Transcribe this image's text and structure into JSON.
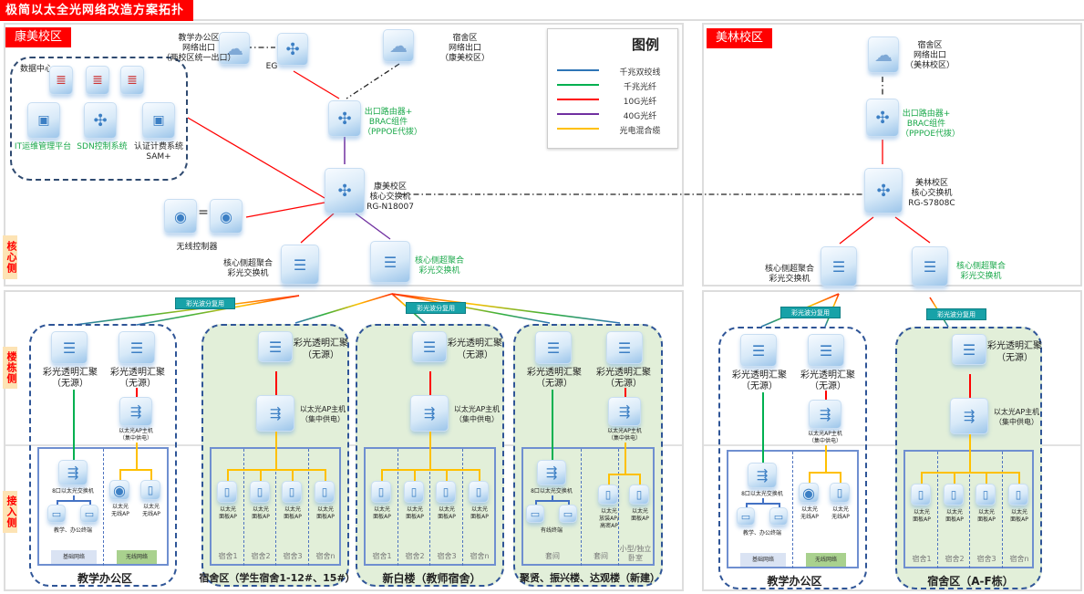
{
  "title": "极简以太全光网络改造方案拓扑示意图",
  "side_labels": {
    "core": "核心侧",
    "building": "楼栋侧",
    "access": "接入侧"
  },
  "legend": {
    "title": "图例",
    "items": [
      {
        "label": "千兆双绞线",
        "color": "#2e75b6"
      },
      {
        "label": "千兆光纤",
        "color": "#00b050"
      },
      {
        "label": "10G光纤",
        "color": "#ff0000"
      },
      {
        "label": "40G光纤",
        "color": "#7030a0"
      },
      {
        "label": "光电混合缆",
        "color": "#ffc000"
      }
    ]
  },
  "wdm_label": "彩光波分复用",
  "kangmei": {
    "name": "康美校区",
    "office_exit": [
      "教学办公区",
      "网络出口",
      "（两校区统一出口）"
    ],
    "eg": "EG",
    "dorm_exit": [
      "宿舍区",
      "网络出口",
      "（康美校区）"
    ],
    "exit_router": [
      "出口路由器+",
      "BRAC组件",
      "（PPPOE代拨）"
    ],
    "core_switch": [
      "康美校区",
      "核心交换机",
      "RG-N18007"
    ],
    "data_center": {
      "label": "数据中心",
      "systems": [
        "IT运维管理平台",
        "SDN控制系统",
        "认证计费系统",
        "SAM+"
      ]
    },
    "wireless_controller": "无线控制器",
    "core_agg_1": [
      "核心侧超聚合",
      "彩光交换机"
    ],
    "core_agg_2": [
      "核心侧超聚合",
      "彩光交换机"
    ],
    "buildings": [
      {
        "type": "office",
        "title": "教学办公区",
        "aggs": [
          {
            "name": "彩光透明汇聚",
            "sub": "（无源）"
          },
          {
            "name": "彩光透明汇聚",
            "sub": "（无源）"
          }
        ],
        "ap_host": "以太光AP主机",
        "ap_host_sub": "（集中供电）",
        "switch": "8口以太光交换机",
        "terminals": "教学、办公终端",
        "aps": [
          {
            "l1": "以太光",
            "l2": "无线AP"
          },
          {
            "l1": "以太光",
            "l2": "无线AP"
          }
        ],
        "footers": [
          "基础网络",
          "无线网络"
        ]
      },
      {
        "type": "dorm",
        "title": "宿舍区（学生宿舍1-12#、15#）",
        "aggs": [
          {
            "name": "彩光透明汇聚",
            "sub": "（无源）"
          }
        ],
        "ap_host": "以太光AP主机",
        "ap_host_sub": "（集中供电）",
        "aps": [
          {
            "l1": "以太光",
            "l2": "面板AP"
          },
          {
            "l1": "以太光",
            "l2": "面板AP"
          },
          {
            "l1": "以太光",
            "l2": "面板AP"
          },
          {
            "l1": "以太光",
            "l2": "面板AP"
          }
        ],
        "rooms": [
          "宿舍1",
          "宿舍2",
          "宿舍3",
          "宿舍n"
        ]
      },
      {
        "type": "dorm",
        "title": "新白楼（教师宿舍）",
        "aggs": [
          {
            "name": "彩光透明汇聚",
            "sub": "（无源）"
          }
        ],
        "ap_host": "以太光AP主机",
        "ap_host_sub": "（集中供电）",
        "aps": [
          {
            "l1": "以太光",
            "l2": "面板AP"
          },
          {
            "l1": "以太光",
            "l2": "面板AP"
          },
          {
            "l1": "以太光",
            "l2": "面板AP"
          },
          {
            "l1": "以太光",
            "l2": "面板AP"
          }
        ],
        "rooms": [
          "宿舍1",
          "宿舍2",
          "宿舍3",
          "宿舍n"
        ]
      },
      {
        "type": "mixed",
        "title": "聚贤、振兴楼、达观楼（新建）",
        "aggs": [
          {
            "name": "彩光透明汇聚",
            "sub": "（无源）"
          },
          {
            "name": "彩光透明汇聚",
            "sub": "（无源）"
          }
        ],
        "ap_host": "以太光AP主机",
        "ap_host_sub": "（集中供电）",
        "switch": "8口以太光交换机",
        "terminals": "有线终端",
        "aps": [
          {
            "l1": "以太光",
            "l2": "放装AP/",
            "l3": "高密AP"
          },
          {
            "l1": "以太光",
            "l2": "面板AP"
          }
        ],
        "rooms": [
          "套间",
          "套间",
          "小型/独立卧室"
        ]
      }
    ]
  },
  "meilin": {
    "name": "美林校区",
    "dorm_exit": [
      "宿舍区",
      "网络出口",
      "（美林校区）"
    ],
    "exit_router": [
      "出口路由器+",
      "BRAC组件",
      "（PPPOE代拨）"
    ],
    "core_switch": [
      "美林校区",
      "核心交换机",
      "RG-S7808C"
    ],
    "core_agg_1": [
      "核心侧超聚合",
      "彩光交换机"
    ],
    "core_agg_2": [
      "核心侧超聚合",
      "彩光交换机"
    ],
    "buildings": [
      {
        "type": "office",
        "title": "教学办公区",
        "aggs": [
          {
            "name": "彩光透明汇聚",
            "sub": "（无源）"
          },
          {
            "name": "彩光透明汇聚",
            "sub": "（无源）"
          }
        ],
        "ap_host": "以太光AP主机",
        "ap_host_sub": "（集中供电）",
        "switch": "8口以太光交换机",
        "terminals": "教学、办公终端",
        "aps": [
          {
            "l1": "以太光",
            "l2": "无线AP"
          },
          {
            "l1": "以太光",
            "l2": "无线AP"
          }
        ],
        "footers": [
          "基础网络",
          "无线网络"
        ]
      },
      {
        "type": "dorm",
        "title": "宿舍区（A-F栋）",
        "aggs": [
          {
            "name": "彩光透明汇聚",
            "sub": "（无源）"
          }
        ],
        "ap_host": "以太光AP主机",
        "ap_host_sub": "（集中供电）",
        "aps": [
          {
            "l1": "以太光",
            "l2": "面板AP"
          },
          {
            "l1": "以太光",
            "l2": "面板AP"
          },
          {
            "l1": "以太光",
            "l2": "面板AP"
          },
          {
            "l1": "以太光",
            "l2": "面板AP"
          }
        ],
        "rooms": [
          "宿舍1",
          "宿舍2",
          "宿舍3",
          "宿舍n"
        ]
      }
    ]
  }
}
